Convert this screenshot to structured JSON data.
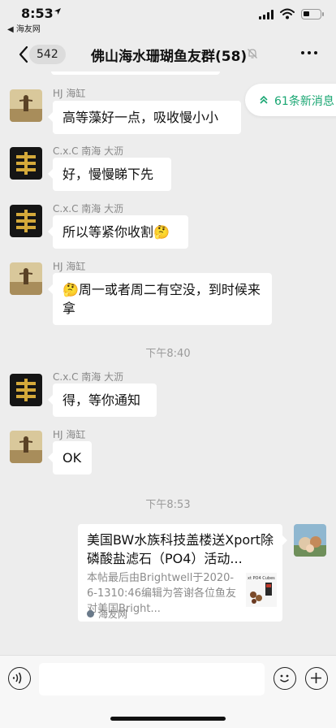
{
  "status_bar": {
    "time": "8:53",
    "back_app": "◀ 海友网"
  },
  "nav": {
    "unread_count": "542",
    "title": "佛山海水珊瑚鱼友群(58)"
  },
  "new_messages_pill": {
    "label": "61条新消息",
    "color": "#19a672"
  },
  "messages": [
    {
      "sender": "HJ 海缸",
      "text": "高等藻好一点，吸收慢小小",
      "avatar": "photo-avatar"
    },
    {
      "sender": "C.x.C 南海 大沥",
      "text": "好，慢慢睇下先",
      "avatar": "gold-emblem-avatar"
    },
    {
      "sender": "C.x.C 南海 大沥",
      "text": "所以等紧你收割🤔",
      "avatar": "gold-emblem-avatar"
    },
    {
      "sender": "HJ 海缸",
      "text": "🤔周一或者周二有空没，到时候来拿",
      "avatar": "photo-avatar"
    },
    {
      "sender": "C.x.C 南海 大沥",
      "text": "得，等你通知",
      "avatar": "gold-emblem-avatar"
    },
    {
      "sender": "HJ 海缸",
      "text": "OK",
      "avatar": "photo-avatar"
    }
  ],
  "timestamps": [
    "下午8:40",
    "下午8:53"
  ],
  "link_card": {
    "title": "美国BW水族科技盖楼送Xport除磷酸盐滤石（PO4）活动...",
    "description": "本帖最后由Brightwell于2020-6-1310:46编辑为答谢各位鱼友对美国Bright...",
    "thumbnail_text": "xt PO4 Cubes",
    "source": "海友网"
  },
  "input": {
    "placeholder": ""
  }
}
